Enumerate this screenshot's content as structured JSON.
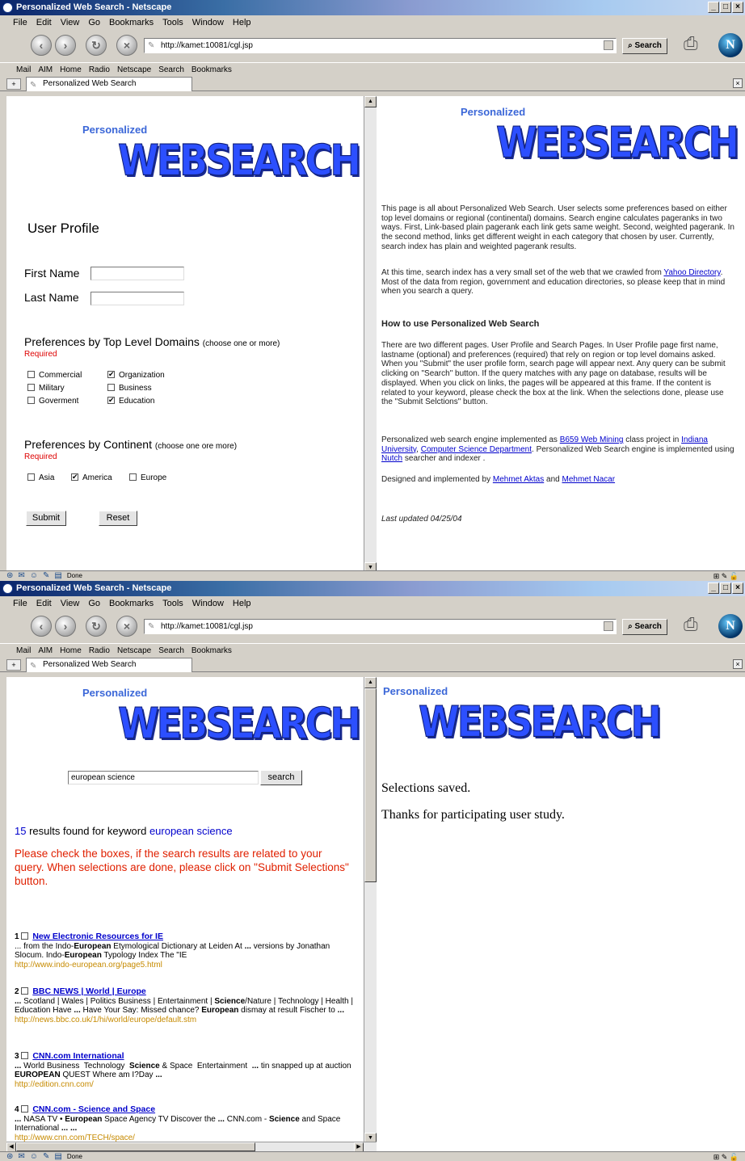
{
  "window_title": "Personalized Web Search - Netscape",
  "menu": [
    "File",
    "Edit",
    "View",
    "Go",
    "Bookmarks",
    "Tools",
    "Window",
    "Help"
  ],
  "url": "http://kamet:10081/cgl.jsp",
  "search_btn": "Search",
  "personal_bar": [
    "Mail",
    "AIM",
    "Home",
    "Radio",
    "Netscape",
    "Search",
    "Bookmarks"
  ],
  "tab_title": "Personalized Web Search",
  "status": "Done",
  "logo": {
    "top": "Personalized",
    "main": "WEBSEARCH"
  },
  "profile": {
    "heading": "User Profile",
    "first_name": "First Name",
    "last_name": "Last Name",
    "tld_heading": "Preferences by Top Level Domains",
    "tld_hint": "(choose one or more)",
    "required": "Required",
    "tld_options": [
      {
        "label": "Commercial",
        "checked": false
      },
      {
        "label": "Organization",
        "checked": true
      },
      {
        "label": "Military",
        "checked": false
      },
      {
        "label": "Business",
        "checked": false
      },
      {
        "label": "Goverment",
        "checked": false
      },
      {
        "label": "Education",
        "checked": true
      }
    ],
    "cont_heading": "Preferences by Continent",
    "cont_hint": "(choose one ore more)",
    "cont_options": [
      {
        "label": "Asia",
        "checked": false
      },
      {
        "label": "America",
        "checked": true
      },
      {
        "label": "Europe",
        "checked": false
      }
    ],
    "submit": "Submit",
    "reset": "Reset"
  },
  "about": {
    "p1": "This page is all about Personalized Web Search. User selects some preferences based on either top level domains or regional (continental) domains. Search engine calculates pageranks in two ways. First, Link-based plain pagerank each link gets same weight. Second, weighted pagerank. In the second method, links get different weight in each category that chosen by user. Currently, search index has plain and weighted pagerank results.",
    "p2a": "At this time, search index has a very small set of the web that we crawled from ",
    "p2link": "Yahoo Directory",
    "p2b": ". Most of the data from region, government and education directories, so please keep that in mind when you search a query.",
    "howto": "How to use Personalized Web Search",
    "p3": "There are two different pages. User Profile and Search Pages. In User Profile page first name, lastname (optional) and preferences (required) that rely on region or top level domains asked. When you \"Submit\" the user profile form, search page will appear next. Any query can be submit clicking on \"Search\" button. If the query matches with any page on database, results will be displayed. When you click on links, the pages will be appeared at this frame. If the content is related to your keyword, please check the box at the link. When the selections done, please use the \"Submit Selctions\" button.",
    "p4a": "Personalized web search engine implemented as ",
    "p4l1": "B659 Web Mining",
    "p4b": " class project in ",
    "p4l2": "Indiana University",
    "p4c": ", ",
    "p4l3": "Computer Science Department",
    "p4d": ". Personalized Web Search engine is implemented using ",
    "p4l4": "Nutch",
    "p4e": " searcher and indexer .",
    "p5a": "Designed and implemented by ",
    "p5l1": "Mehmet Aktas",
    "p5b": " and ",
    "p5l2": "Mehmet Nacar",
    "updated": "Last updated 04/25/04"
  },
  "search": {
    "query": "european science",
    "button": "search",
    "count": "15",
    "found_text": " results found for keyword ",
    "keyword": "european science",
    "instructions": "Please check the boxes, if the search results are related to your query. When selections are done, please click on \"Submit Selections\" button.",
    "results": [
      {
        "num": "1",
        "title": "New Electronic Resources for IE",
        "snippet": "... from the Indo-European Etymological Dictionary at Leiden At ... versions by Jonathan Slocum. Indo-European Typology Index The \"IE",
        "url": "http://www.indo-european.org/page5.html"
      },
      {
        "num": "2",
        "title": "BBC NEWS | World | Europe",
        "snippet": "... Scotland | Wales | Politics Business | Entertainment | Science/Nature | Technology | Health | Education Have ... Have Your Say: Missed chance? European dismay at result Fischer to ...",
        "url": "http://news.bbc.co.uk/1/hi/world/europe/default.stm"
      },
      {
        "num": "3",
        "title": "CNN.com International",
        "snippet": "... World Business  Technology  Science & Space  Entertainment  ... tin snapped up at auction EUROPEAN QUEST Where am I?Day ...",
        "url": "http://edition.cnn.com/"
      },
      {
        "num": "4",
        "title": "CNN.com - Science and Space",
        "snippet": "... NASA TV • European Space Agency TV Discover the ... CNN.com - Science and Space International ... ...",
        "url": "http://www.cnn.com/TECH/space/"
      }
    ]
  },
  "saved": {
    "line1": "Selections saved.",
    "line2": "Thanks for participating user study."
  }
}
